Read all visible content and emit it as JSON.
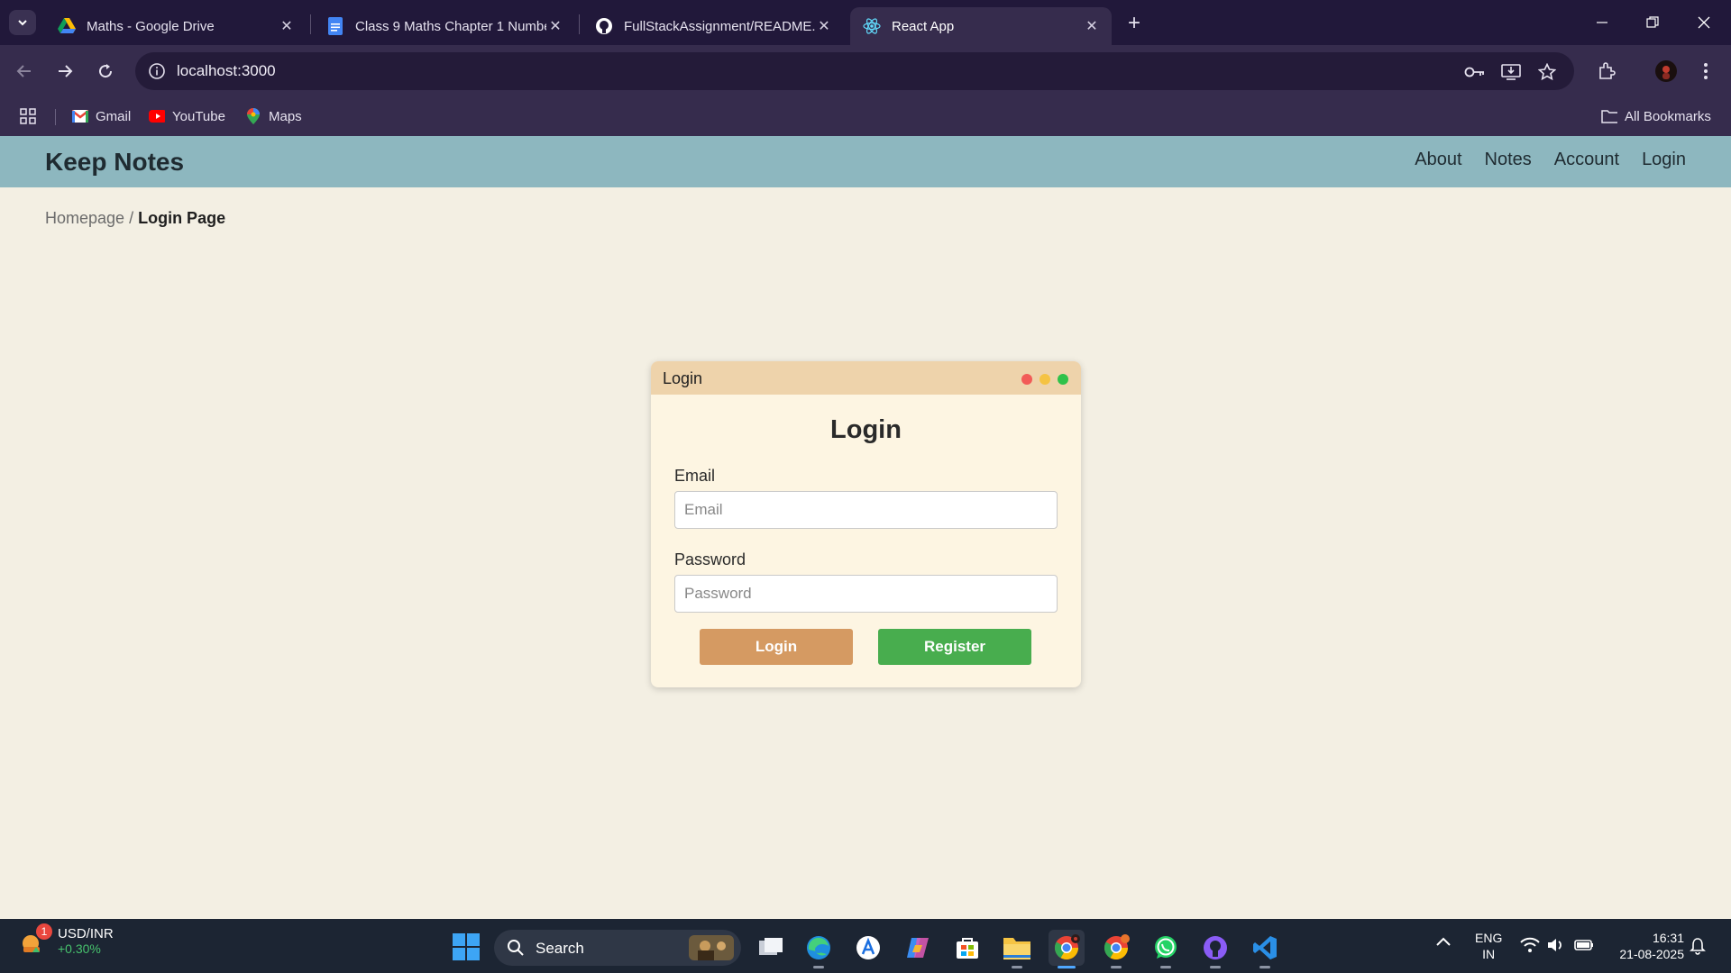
{
  "browser": {
    "tabs": [
      {
        "title": "Maths - Google Drive",
        "icon": "google-drive-icon"
      },
      {
        "title": "Class 9 Maths Chapter 1 Number",
        "icon": "google-docs-icon"
      },
      {
        "title": "FullStackAssignment/README.md",
        "icon": "github-icon"
      },
      {
        "title": "React App",
        "icon": "react-icon"
      }
    ],
    "url": "localhost:3000",
    "bookmarks": [
      {
        "label": "Gmail",
        "icon": "gmail-icon"
      },
      {
        "label": "YouTube",
        "icon": "youtube-icon"
      },
      {
        "label": "Maps",
        "icon": "maps-icon"
      }
    ],
    "all_bookmarks": "All Bookmarks"
  },
  "app": {
    "brand": "Keep Notes",
    "nav": [
      "About",
      "Notes",
      "Account",
      "Login"
    ],
    "breadcrumb": {
      "home": "Homepage",
      "separator": " / ",
      "current": "Login Page"
    }
  },
  "login": {
    "window_title": "Login",
    "heading": "Login",
    "email_label": "Email",
    "email_placeholder": "Email",
    "password_label": "Password",
    "password_placeholder": "Password",
    "login_button": "Login",
    "register_button": "Register"
  },
  "taskbar": {
    "ticker_title": "USD/INR",
    "ticker_change": "+0.30%",
    "ticker_badge": "1",
    "search_label": "Search",
    "lang_line1": "ENG",
    "lang_line2": "IN",
    "time": "16:31",
    "date": "21-08-2025"
  },
  "colors": {
    "nav_bar": "#8db7bf",
    "page_bg": "#f3efe3",
    "card_header": "#eed3ab",
    "login_button": "#d59a62",
    "register_button": "#48ad4e"
  }
}
